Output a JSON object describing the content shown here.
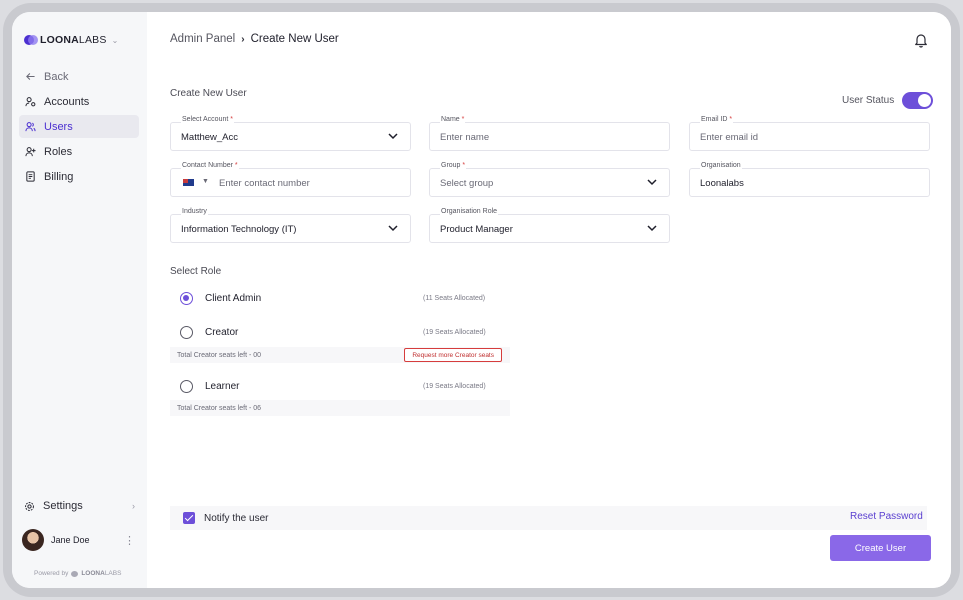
{
  "sidebar": {
    "logo": {
      "bold": "LOONA",
      "light": "LABS"
    },
    "items": [
      {
        "label": "Back",
        "icon": "arrow-left-icon"
      },
      {
        "label": "Accounts",
        "icon": "accounts-icon"
      },
      {
        "label": "Users",
        "icon": "users-icon",
        "active": true
      },
      {
        "label": "Roles",
        "icon": "roles-icon"
      },
      {
        "label": "Billing",
        "icon": "billing-icon"
      }
    ],
    "settings_label": "Settings",
    "user_name": "Jane Doe",
    "powered_prefix": "Powered by",
    "powered_bold": "LOONA",
    "powered_light": "LABS"
  },
  "header": {
    "crumb_root": "Admin Panel",
    "crumb_current": "Create New User"
  },
  "form": {
    "title": "Create New User",
    "user_status_label": "User Status",
    "user_status_on": true,
    "select_account": {
      "label": "Select Account",
      "value": "Matthew_Acc"
    },
    "name": {
      "label": "Name",
      "placeholder": "Enter name"
    },
    "email": {
      "label": "Email ID",
      "placeholder": "Enter email id"
    },
    "contact": {
      "label": "Contact Number",
      "placeholder": "Enter contact number"
    },
    "group": {
      "label": "Group",
      "placeholder": "Select group"
    },
    "organisation": {
      "label": "Organisation",
      "value": "Loonalabs"
    },
    "industry": {
      "label": "Industry",
      "value": "Information Technology (IT)"
    },
    "org_role": {
      "label": "Organisation Role",
      "value": "Product Manager"
    }
  },
  "roles": {
    "title": "Select Role",
    "items": [
      {
        "name": "Client Admin",
        "seats": "(11 Seats Allocated)",
        "checked": true
      },
      {
        "name": "Creator",
        "seats": "(19 Seats Allocated)",
        "checked": false,
        "left": "Total Creator seats left - 00",
        "request": "Request more Creator seats"
      },
      {
        "name": "Learner",
        "seats": "(19 Seats Allocated)",
        "checked": false,
        "left": "Total Creator seats left - 06"
      }
    ]
  },
  "footer": {
    "notify_label": "Notify the user",
    "notify_checked": true,
    "reset_label": "Reset Password",
    "create_label": "Create User"
  },
  "colors": {
    "accent": "#6d4fd9",
    "button": "#8a68e8",
    "danger": "#d63d3d"
  }
}
